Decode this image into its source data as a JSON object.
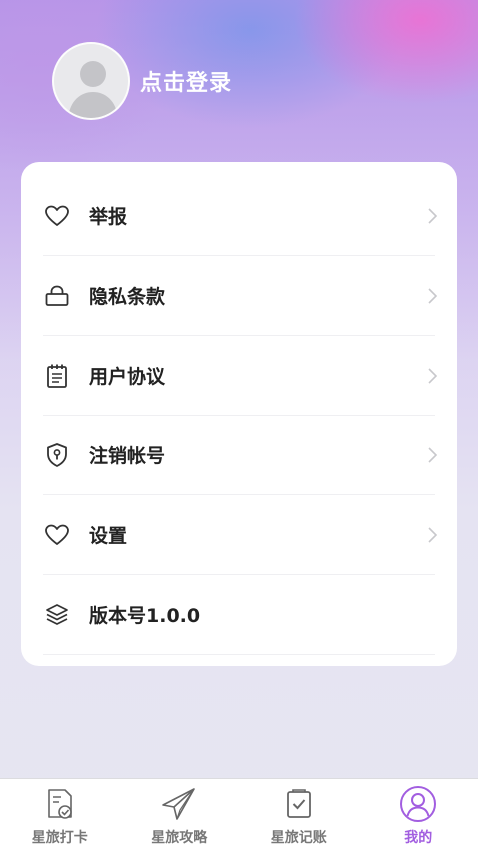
{
  "profile": {
    "login_label": "点击登录"
  },
  "menu": {
    "items": [
      {
        "label": "举报",
        "icon": "heart-icon",
        "has_arrow": true
      },
      {
        "label": "隐私条款",
        "icon": "lock-icon",
        "has_arrow": true
      },
      {
        "label": "用户协议",
        "icon": "notepad-icon",
        "has_arrow": true
      },
      {
        "label": "注销帐号",
        "icon": "shield-keyhole-icon",
        "has_arrow": true
      },
      {
        "label": "设置",
        "icon": "heart-icon",
        "has_arrow": true
      },
      {
        "label": "版本号1.0.0",
        "icon": "layers-icon",
        "has_arrow": false
      }
    ]
  },
  "tabbar": {
    "tabs": [
      {
        "label": "星旅打卡",
        "icon": "checkin-document-icon",
        "active": false
      },
      {
        "label": "星旅攻略",
        "icon": "paper-plane-icon",
        "active": false
      },
      {
        "label": "星旅记账",
        "icon": "checklist-icon",
        "active": false
      },
      {
        "label": "我的",
        "icon": "user-circle-icon",
        "active": true
      }
    ]
  },
  "colors": {
    "accent": "#a25ee0",
    "label": "#222222",
    "tab_inactive": "#777777"
  }
}
